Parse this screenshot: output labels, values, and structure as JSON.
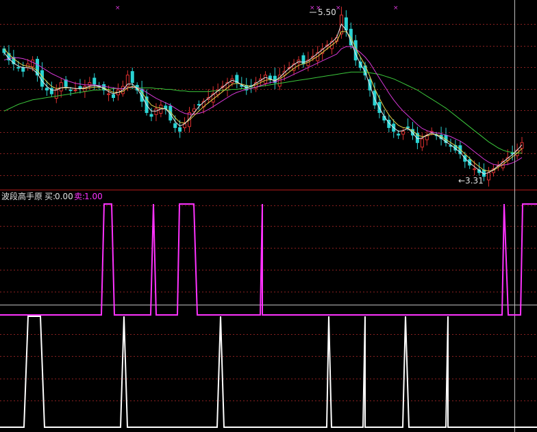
{
  "colors": {
    "background": "#000000",
    "divider": "#b01818",
    "grid": "#8a2020",
    "crosshair": "#bfbfbf",
    "up_candle": "#e03030",
    "down_candle": "#2ad4d4",
    "ma_white": "#e8e8e8",
    "ma_yellow": "#e6d24a",
    "ma_magenta": "#d838d8",
    "ma_green": "#3cc83c",
    "sell_line": "#ff33ff",
    "buy_line": "#ffffff",
    "marker": "#d838d8",
    "indicator_name": "#e0e0e0",
    "buy_text": "#e0e0e0",
    "sell_text": "#ff33ff"
  },
  "indicator": {
    "name": "波段高手原",
    "buy_label": "买:",
    "buy_value": "0.00",
    "sell_label": "卖:",
    "sell_value": "1.00"
  },
  "annotations": {
    "high_label": "5.50",
    "low_label": "←3.31"
  },
  "chart_data": [
    {
      "type": "candlestick",
      "title": "",
      "price_range": [
        3.31,
        5.5
      ],
      "marked_high": 5.5,
      "marked_low": 3.31,
      "closes": [
        5.0,
        4.9,
        4.85,
        4.8,
        4.75,
        4.85,
        4.9,
        4.7,
        4.55,
        4.5,
        4.45,
        4.5,
        4.6,
        4.55,
        4.5,
        4.5,
        4.52,
        4.55,
        4.6,
        4.58,
        4.55,
        4.5,
        4.45,
        4.4,
        4.5,
        4.55,
        4.7,
        4.6,
        4.5,
        4.35,
        4.2,
        4.15,
        4.25,
        4.3,
        4.25,
        4.1,
        4.0,
        3.95,
        4.05,
        4.2,
        4.25,
        4.3,
        4.35,
        4.4,
        4.45,
        4.5,
        4.55,
        4.6,
        4.65,
        4.6,
        4.55,
        4.5,
        4.55,
        4.6,
        4.65,
        4.7,
        4.65,
        4.6,
        4.7,
        4.75,
        4.8,
        4.85,
        4.9,
        4.85,
        4.9,
        4.95,
        5.0,
        5.05,
        5.1,
        5.15,
        5.2,
        5.5,
        5.3,
        5.1,
        4.9,
        4.8,
        4.7,
        4.5,
        4.3,
        4.2,
        4.1,
        4.0,
        3.95,
        3.9,
        3.95,
        4.0,
        3.9,
        3.8,
        3.85,
        3.9,
        3.95,
        3.9,
        3.85,
        3.8,
        3.75,
        3.7,
        3.65,
        3.55,
        3.5,
        3.45,
        3.4,
        3.35,
        3.4,
        3.45,
        3.5,
        3.55,
        3.6,
        3.65,
        3.7,
        3.8
      ],
      "ma_white": [
        5.0,
        4.92,
        4.86,
        4.82,
        4.8,
        4.8,
        4.78,
        4.72,
        4.62,
        4.55,
        4.5,
        4.5,
        4.53,
        4.54,
        4.53,
        4.52,
        4.52,
        4.53,
        4.55,
        4.56,
        4.55,
        4.52,
        4.48,
        4.45,
        4.47,
        4.5,
        4.58,
        4.58,
        4.52,
        4.42,
        4.3,
        4.22,
        4.22,
        4.25,
        4.25,
        4.18,
        4.08,
        4.02,
        4.05,
        4.12,
        4.2,
        4.28,
        4.34,
        4.39,
        4.44,
        4.49,
        4.54,
        4.59,
        4.63,
        4.61,
        4.57,
        4.53,
        4.55,
        4.59,
        4.63,
        4.67,
        4.65,
        4.62,
        4.67,
        4.73,
        4.79,
        4.84,
        4.88,
        4.87,
        4.89,
        4.94,
        4.99,
        5.04,
        5.09,
        5.14,
        5.2,
        5.38,
        5.3,
        5.15,
        4.98,
        4.85,
        4.74,
        4.56,
        4.38,
        4.26,
        4.15,
        4.06,
        4.0,
        3.95,
        3.96,
        3.99,
        3.93,
        3.85,
        3.86,
        3.9,
        3.93,
        3.9,
        3.86,
        3.81,
        3.77,
        3.72,
        3.67,
        3.59,
        3.53,
        3.48,
        3.43,
        3.38,
        3.4,
        3.44,
        3.49,
        3.54,
        3.59,
        3.64,
        3.7,
        3.77
      ],
      "ma_yellow": [
        5.05,
        4.98,
        4.92,
        4.87,
        4.83,
        4.82,
        4.8,
        4.76,
        4.68,
        4.61,
        4.55,
        4.52,
        4.53,
        4.53,
        4.53,
        4.52,
        4.52,
        4.52,
        4.53,
        4.54,
        4.54,
        4.53,
        4.5,
        4.47,
        4.47,
        4.48,
        4.53,
        4.55,
        4.53,
        4.47,
        4.38,
        4.3,
        4.27,
        4.26,
        4.25,
        4.21,
        4.13,
        4.07,
        4.06,
        4.1,
        4.16,
        4.22,
        4.28,
        4.33,
        4.38,
        4.43,
        4.48,
        4.53,
        4.58,
        4.59,
        4.58,
        4.56,
        4.55,
        4.57,
        4.6,
        4.63,
        4.64,
        4.63,
        4.65,
        4.69,
        4.74,
        4.79,
        4.83,
        4.85,
        4.87,
        4.91,
        4.95,
        5.0,
        5.05,
        5.1,
        5.15,
        5.28,
        5.28,
        5.2,
        5.06,
        4.94,
        4.83,
        4.68,
        4.52,
        4.39,
        4.27,
        4.17,
        4.09,
        4.03,
        4.0,
        3.99,
        3.96,
        3.9,
        3.88,
        3.89,
        3.91,
        3.91,
        3.88,
        3.84,
        3.8,
        3.76,
        3.71,
        3.65,
        3.59,
        3.53,
        3.48,
        3.43,
        3.42,
        3.43,
        3.47,
        3.51,
        3.56,
        3.61,
        3.66,
        3.72
      ],
      "ma_magenta": [
        4.9,
        4.92,
        4.93,
        4.93,
        4.92,
        4.9,
        4.87,
        4.84,
        4.8,
        4.76,
        4.72,
        4.69,
        4.66,
        4.63,
        4.61,
        4.59,
        4.58,
        4.57,
        4.57,
        4.57,
        4.56,
        4.55,
        4.54,
        4.53,
        4.52,
        4.52,
        4.53,
        4.54,
        4.53,
        4.51,
        4.47,
        4.43,
        4.39,
        4.36,
        4.33,
        4.3,
        4.26,
        4.22,
        4.19,
        4.18,
        4.18,
        4.19,
        4.21,
        4.24,
        4.28,
        4.32,
        4.36,
        4.4,
        4.44,
        4.47,
        4.49,
        4.51,
        4.52,
        4.54,
        4.56,
        4.58,
        4.6,
        4.61,
        4.63,
        4.65,
        4.68,
        4.71,
        4.74,
        4.77,
        4.8,
        4.83,
        4.86,
        4.89,
        4.92,
        4.95,
        4.98,
        5.05,
        5.08,
        5.08,
        5.05,
        5.0,
        4.94,
        4.86,
        4.76,
        4.66,
        4.56,
        4.46,
        4.37,
        4.29,
        4.22,
        4.16,
        4.1,
        4.04,
        3.99,
        3.96,
        3.94,
        3.93,
        3.92,
        3.9,
        3.88,
        3.85,
        3.82,
        3.78,
        3.73,
        3.68,
        3.63,
        3.58,
        3.54,
        3.51,
        3.5,
        3.5,
        3.51,
        3.53,
        3.56,
        3.6
      ],
      "ma_green": [
        4.22,
        4.25,
        4.28,
        4.31,
        4.33,
        4.35,
        4.37,
        4.38,
        4.39,
        4.4,
        4.41,
        4.42,
        4.43,
        4.44,
        4.45,
        4.46,
        4.47,
        4.48,
        4.49,
        4.5,
        4.5,
        4.51,
        4.51,
        4.52,
        4.52,
        4.52,
        4.53,
        4.53,
        4.53,
        4.53,
        4.53,
        4.53,
        4.52,
        4.52,
        4.51,
        4.51,
        4.5,
        4.49,
        4.49,
        4.48,
        4.48,
        4.48,
        4.48,
        4.48,
        4.49,
        4.49,
        4.5,
        4.5,
        4.51,
        4.51,
        4.52,
        4.52,
        4.53,
        4.54,
        4.55,
        4.56,
        4.57,
        4.58,
        4.59,
        4.6,
        4.61,
        4.62,
        4.63,
        4.64,
        4.65,
        4.66,
        4.67,
        4.68,
        4.69,
        4.7,
        4.71,
        4.72,
        4.73,
        4.74,
        4.74,
        4.74,
        4.74,
        4.73,
        4.72,
        4.71,
        4.69,
        4.67,
        4.65,
        4.62,
        4.59,
        4.56,
        4.53,
        4.5,
        4.46,
        4.42,
        4.38,
        4.34,
        4.3,
        4.26,
        4.21,
        4.16,
        4.11,
        4.06,
        4.01,
        3.96,
        3.91,
        3.86,
        3.81,
        3.77,
        3.73,
        3.7,
        3.68,
        3.67,
        3.66,
        3.66
      ]
    },
    {
      "type": "line",
      "title": "波段高手原",
      "series": [
        {
          "name": "卖",
          "current_value": 1.0,
          "segments": [
            [
              0,
              148,
              0
            ],
            [
              148,
              152,
              1
            ],
            [
              152,
              163,
              1
            ],
            [
              163,
              167,
              0
            ],
            [
              167,
              220,
              0
            ],
            [
              220,
              224,
              1
            ],
            [
              224,
              228,
              0
            ],
            [
              228,
              259,
              0
            ],
            [
              259,
              262,
              1
            ],
            [
              262,
              283,
              1
            ],
            [
              283,
              288,
              0
            ],
            [
              288,
              380,
              0
            ],
            [
              380,
              383,
              1
            ],
            [
              383,
              393,
              0
            ],
            [
              393,
              733,
              0
            ],
            [
              733,
              736,
              1
            ],
            [
              736,
              742,
              0
            ],
            [
              742,
              760,
              0
            ],
            [
              760,
              763,
              1
            ],
            [
              763,
              784,
              1
            ]
          ]
        },
        {
          "name": "买",
          "current_value": 0.0,
          "segments": [
            [
              0,
              35,
              0
            ],
            [
              35,
              41,
              1
            ],
            [
              41,
              59,
              1
            ],
            [
              59,
              65,
              0
            ],
            [
              65,
              176,
              0
            ],
            [
              176,
              181,
              1
            ],
            [
              181,
              186,
              0
            ],
            [
              186,
              317,
              0
            ],
            [
              317,
              322,
              1
            ],
            [
              322,
              327,
              0
            ],
            [
              327,
              477,
              0
            ],
            [
              477,
              480,
              1
            ],
            [
              480,
              484,
              0
            ],
            [
              484,
              530,
              0
            ],
            [
              530,
              533,
              1
            ],
            [
              533,
              540,
              0
            ],
            [
              540,
              588,
              0
            ],
            [
              588,
              592,
              1
            ],
            [
              592,
              597,
              0
            ],
            [
              597,
              651,
              0
            ],
            [
              651,
              654,
              1
            ],
            [
              654,
              665,
              0
            ],
            [
              665,
              784,
              0
            ]
          ]
        }
      ]
    }
  ]
}
